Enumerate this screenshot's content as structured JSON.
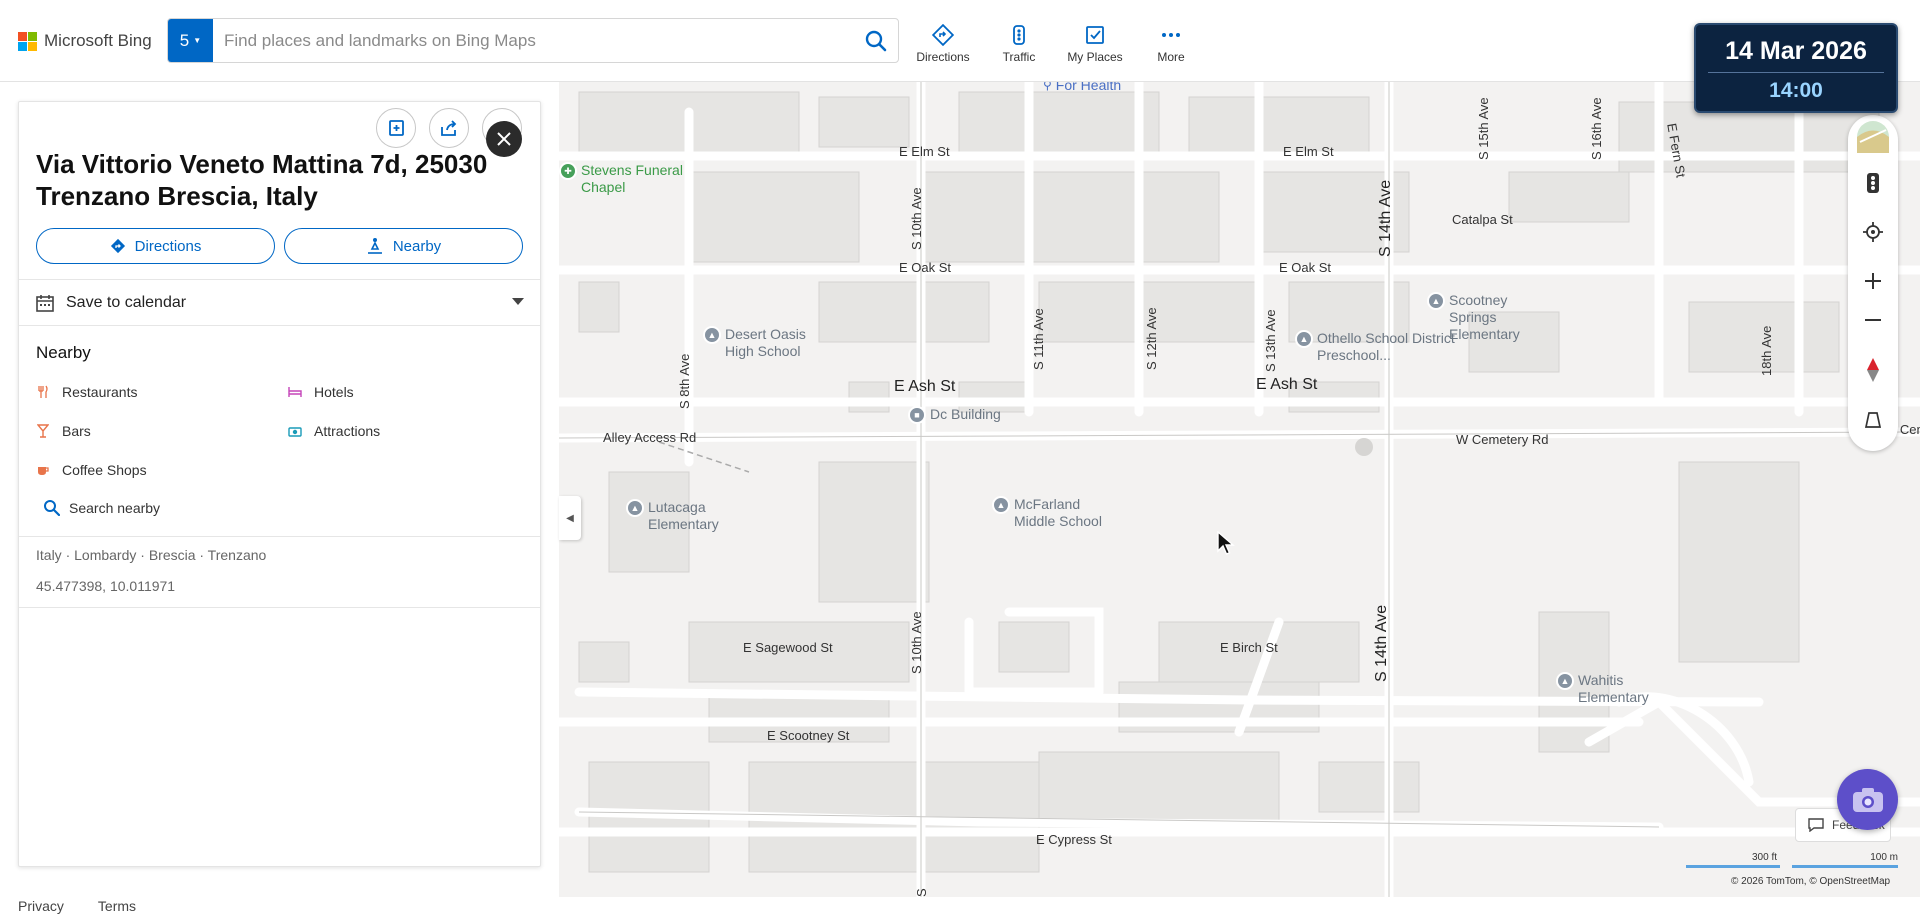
{
  "header": {
    "logo_text": "Microsoft Bing",
    "logo_colors": [
      "#f25022",
      "#7fba00",
      "#00a4ef",
      "#ffb900"
    ],
    "results_count": "5",
    "search_placeholder": "Find places and landmarks on Bing Maps",
    "nav": [
      {
        "label": "Directions",
        "icon": "directions-icon"
      },
      {
        "label": "Traffic",
        "icon": "traffic-icon"
      },
      {
        "label": "My Places",
        "icon": "my-places-icon"
      },
      {
        "label": "More",
        "icon": "more-icon"
      }
    ],
    "accent_color": "#0067c5"
  },
  "datetime": {
    "date": "14 Mar 2026",
    "time": "14:00"
  },
  "panel": {
    "title": "Via Vittorio Veneto Mattina 7d, 25030 Trenzano Brescia, Italy",
    "directions_label": "Directions",
    "nearby_label": "Nearby",
    "calendar_label": "Save to calendar",
    "nearby_heading": "Nearby",
    "categories": [
      {
        "label": "Restaurants",
        "icon": "restaurant-icon"
      },
      {
        "label": "Hotels",
        "icon": "hotel-icon"
      },
      {
        "label": "Bars",
        "icon": "bar-icon"
      },
      {
        "label": "Attractions",
        "icon": "attraction-icon"
      },
      {
        "label": "Coffee Shops",
        "icon": "coffee-icon"
      }
    ],
    "search_nearby_label": "Search nearby",
    "breadcrumb": "Italy · Lombardy · Brescia · Trenzano",
    "coordinates": "45.477398, 10.011971"
  },
  "footer": {
    "privacy": "Privacy",
    "terms": "Terms"
  },
  "map": {
    "streets": {
      "e_elm_1": "E Elm St",
      "e_elm_2": "E Elm St",
      "e_oak_1": "E Oak St",
      "e_oak_2": "E Oak St",
      "e_ash_1": "E Ash St",
      "e_ash_2": "E Ash St",
      "catalpa": "Catalpa St",
      "alley": "Alley Access Rd",
      "w_cemetery": "W Cemetery Rd",
      "cem_partial": "W Cem",
      "sagewood": "E Sagewood St",
      "birch": "E Birch St",
      "scootney": "E Scootney St",
      "cypress": "E Cypress St",
      "s10_top": "S 10th Ave",
      "s10_bottom": "S 10th Ave",
      "s14_top": "S 14th Ave",
      "s14_bottom": "S 14th Ave",
      "s8": "S 8th Ave",
      "s11": "S 11th Ave",
      "s12": "S 12th Ave",
      "s13": "S 13th Ave",
      "s15": "S 15th Ave",
      "s16": "S 16th Ave",
      "s18": "18th Ave",
      "fern": "E Fern St",
      "s_partial": "S"
    },
    "pois": {
      "for_health": "For Health",
      "stevens": "Stevens Funeral Chapel",
      "desert_oasis": "Desert Oasis High School",
      "dc_building": "Dc Building",
      "othello": "Othello School District Preschool...",
      "scootney_springs": "Scootney Springs Elementary",
      "lutacaga": "Lutacaga Elementary",
      "mcfarland": "McFarland Middle School",
      "wahitis": "Wahitis Elementary"
    },
    "feedback_label": "Feedback",
    "scale_ft": "300 ft",
    "scale_m": "100 m",
    "copyright": "© 2026 TomTom,  © OpenStreetMap"
  }
}
